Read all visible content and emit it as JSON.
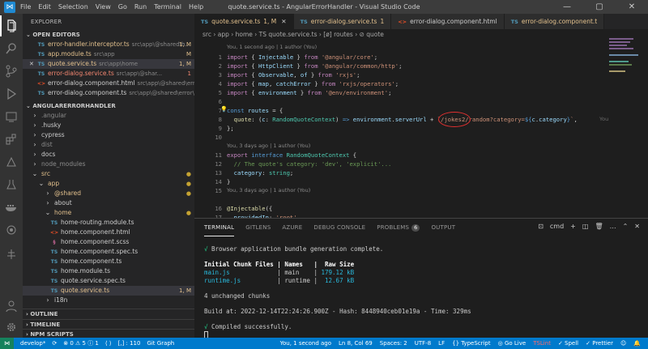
{
  "titlebar": {
    "menus": [
      "File",
      "Edit",
      "Selection",
      "View",
      "Go",
      "Run",
      "Terminal",
      "Help"
    ],
    "title": "quote.service.ts - AngularErrorHandler - Visual Studio Code"
  },
  "sidebar": {
    "title": "EXPLORER",
    "open_editors_header": "OPEN EDITORS",
    "open_editors": [
      {
        "name": "error-handler.interceptor.ts",
        "path": "src\\app\\@shared\\h...",
        "badge": "1, M",
        "icon": "TS",
        "type": "ts",
        "prefix": ""
      },
      {
        "name": "app.module.ts",
        "path": "src\\app",
        "badge": "M",
        "icon": "TS",
        "type": "ts",
        "prefix": ""
      },
      {
        "name": "quote.service.ts",
        "path": "src\\app\\home",
        "badge": "1, M",
        "icon": "TS",
        "type": "ts",
        "prefix": "✕"
      },
      {
        "name": "error-dialog.service.ts",
        "path": "src\\app\\@shar...",
        "badge": "1",
        "icon": "TS",
        "type": "ts",
        "prefix": ""
      },
      {
        "name": "error-dialog.component.html",
        "path": "src\\app\\@shared\\error\\...",
        "badge": "",
        "icon": "<>",
        "type": "html",
        "prefix": ""
      },
      {
        "name": "error-dialog.component.ts",
        "path": "src\\app\\@shared\\error\\...",
        "badge": "",
        "icon": "TS",
        "type": "ts",
        "prefix": ""
      }
    ],
    "project_header": "ANGULARERRORHANDLER",
    "tree": [
      {
        "name": ".angular",
        "indent": 0,
        "icon": "›",
        "type": "folder",
        "badge": ""
      },
      {
        "name": ".husky",
        "indent": 0,
        "icon": "›",
        "type": "folder",
        "badge": ""
      },
      {
        "name": "cypress",
        "indent": 0,
        "icon": "›",
        "type": "folder",
        "badge": ""
      },
      {
        "name": "dist",
        "indent": 0,
        "icon": "›",
        "type": "folder",
        "badge": ""
      },
      {
        "name": "docs",
        "indent": 0,
        "icon": "›",
        "type": "folder",
        "badge": ""
      },
      {
        "name": "node_modules",
        "indent": 0,
        "icon": "›",
        "type": "folder",
        "badge": ""
      },
      {
        "name": "src",
        "indent": 0,
        "icon": "⌄",
        "type": "folder-mod",
        "badge": "●"
      },
      {
        "name": "app",
        "indent": 1,
        "icon": "⌄",
        "type": "folder-mod",
        "badge": "●"
      },
      {
        "name": "@shared",
        "indent": 2,
        "icon": "›",
        "type": "folder-mod",
        "badge": "●"
      },
      {
        "name": "about",
        "indent": 2,
        "icon": "›",
        "type": "folder",
        "badge": ""
      },
      {
        "name": "home",
        "indent": 2,
        "icon": "⌄",
        "type": "folder-mod",
        "badge": "●"
      },
      {
        "name": "home-routing.module.ts",
        "indent": 3,
        "icon": "TS",
        "type": "ts",
        "badge": ""
      },
      {
        "name": "home.component.html",
        "indent": 3,
        "icon": "<>",
        "type": "html",
        "badge": ""
      },
      {
        "name": "home.component.scss",
        "indent": 3,
        "icon": "§",
        "type": "scss",
        "badge": ""
      },
      {
        "name": "home.component.spec.ts",
        "indent": 3,
        "icon": "TS",
        "type": "ts",
        "badge": ""
      },
      {
        "name": "home.component.ts",
        "indent": 3,
        "icon": "TS",
        "type": "ts",
        "badge": ""
      },
      {
        "name": "home.module.ts",
        "indent": 3,
        "icon": "TS",
        "type": "ts",
        "badge": ""
      },
      {
        "name": "quote.service.spec.ts",
        "indent": 3,
        "icon": "TS",
        "type": "ts",
        "badge": ""
      },
      {
        "name": "quote.service.ts",
        "indent": 3,
        "icon": "TS",
        "type": "ts-sel",
        "badge": "1, M"
      },
      {
        "name": "i18n",
        "indent": 2,
        "icon": "›",
        "type": "folder",
        "badge": ""
      }
    ],
    "bottom_sections": [
      "OUTLINE",
      "TIMELINE",
      "NPM SCRIPTS"
    ]
  },
  "editor": {
    "tabs": [
      {
        "name": "quote.service.ts",
        "badge": "1, M",
        "active": true,
        "icon": "TS"
      },
      {
        "name": "error-dialog.service.ts",
        "badge": "1",
        "active": false,
        "icon": "TS"
      },
      {
        "name": "error-dialog.component.html",
        "badge": "",
        "active": false,
        "icon": "<>"
      },
      {
        "name": "error-dialog.component.t",
        "badge": "",
        "active": false,
        "icon": "TS"
      }
    ],
    "breadcrumb": "src › app › home › TS quote.service.ts › [ø] routes › ⊘ quote",
    "lens1": "You, 1 second ago | 1 author (You)",
    "lens2": "You, 3 days ago | 1 author (You)",
    "lens3": "You, 3 days ago | 1 author (You)",
    "blame_inline": "You",
    "lines": [
      {
        "n": "1",
        "html": "<span class='kw'>import</span> { <span class='va'>Injectable</span> } <span class='kw'>from</span> <span class='st'>'@angular/core'</span>;"
      },
      {
        "n": "2",
        "html": "<span class='kw'>import</span> { <span class='va'>HttpClient</span> } <span class='kw'>from</span> <span class='st'>'@angular/common/http'</span>;"
      },
      {
        "n": "3",
        "html": "<span class='kw'>import</span> { <span class='va'>Observable</span>, <span class='va'>of</span> } <span class='kw'>from</span> <span class='st'>'rxjs'</span>;"
      },
      {
        "n": "4",
        "html": "<span class='kw'>import</span> { <span class='va'>map</span>, <span class='va'>catchError</span> } <span class='kw'>from</span> <span class='st'>'rxjs/operators'</span>;"
      },
      {
        "n": "5",
        "html": "<span class='kw'>import</span> { <span class='va'>environment</span> } <span class='kw'>from</span> <span class='st'>'@env/environment'</span>;"
      },
      {
        "n": "6",
        "html": ""
      },
      {
        "n": "7",
        "html": "<span class='bl'>const</span> <span class='va'>routes</span> = {"
      },
      {
        "n": "8",
        "html": "  <span class='fn'>quote</span>: (<span class='va'>c</span>: <span class='ty'>RandomQuoteContext</span>) <span class='bl'>=&gt;</span> <span class='va'>environment</span>.<span class='va'>serverUrl</span> + <span class='st'>`/jokes2/random?category=</span><span class='bl'>${</span><span class='va'>c</span>.<span class='va'>category</span><span class='bl'>}</span><span class='st'>`</span>,"
      },
      {
        "n": "9",
        "html": "};"
      },
      {
        "n": "10",
        "html": ""
      },
      {
        "n": "11",
        "html": "<span class='kw'>export</span> <span class='bl'>interface</span> <span class='ty'>RandomQuoteContext</span> {"
      },
      {
        "n": "12",
        "html": "  <span class='cm'>// The quote's category: 'dev', 'explicit'...</span>"
      },
      {
        "n": "13",
        "html": "  <span class='va'>category</span>: <span class='ty'>string</span>;"
      },
      {
        "n": "14",
        "html": "}"
      },
      {
        "n": "15",
        "html": ""
      },
      {
        "n": "16",
        "html": "<span class='fn'>@Injectable</span>({"
      },
      {
        "n": "17",
        "html": "  <span class='va'>providedIn</span>: <span class='st'>'root'</span>,"
      },
      {
        "n": "18",
        "html": "})"
      }
    ]
  },
  "panel": {
    "tabs": [
      "TERMINAL",
      "GITLENS",
      "AZURE",
      "DEBUG CONSOLE",
      "PROBLEMS",
      "OUTPUT"
    ],
    "problems_count": "6",
    "shell": "cmd",
    "output": {
      "l1": "√ Browser application bundle generation complete.",
      "h_files": "Initial Chunk Files",
      "h_names": "Names",
      "h_size": "Raw Size",
      "f1": "main.js",
      "n1": "main",
      "s1": "179.12 kB",
      "f2": "runtime.js",
      "n2": "runtime",
      "s2": "12.67 kB",
      "unchanged": "4 unchanged chunks",
      "build": "Build at: 2022-12-14T22:24:26.900Z - Hash: 8448940ceb01e19a - Time: 329ms",
      "compiled": "√ Compiled successfully."
    }
  },
  "statusbar": {
    "branch": "develop*",
    "sync": "⟳",
    "errors": "⊗ 0 ⚠ 5 ⓘ 1",
    "live": "⟨ ⟩",
    "items": "[,] : 110",
    "git_graph": "Git Graph",
    "blame": "You, 1 second ago",
    "position": "Ln 8, Col 69",
    "spaces": "Spaces: 2",
    "encoding": "UTF-8",
    "eol": "LF",
    "lang": "{} TypeScript",
    "golive": "◎ Go Live",
    "tslint": "TSLint",
    "spell": "✓ Spell",
    "prettier": "✓ Prettier"
  },
  "colors": {
    "accent": "#007acc",
    "annotation_circle": "#e03030"
  }
}
